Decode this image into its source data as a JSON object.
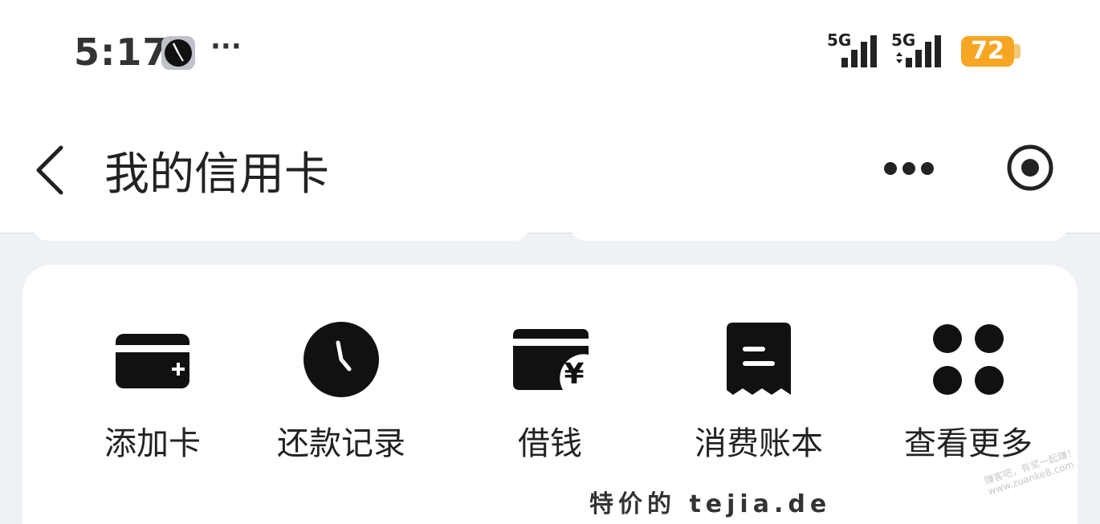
{
  "status": {
    "time": "5:17",
    "more": "···",
    "network1": "5G",
    "network2": "5G",
    "battery": "72",
    "battery_color": "#f6a623"
  },
  "nav": {
    "back_icon": "chevron-left-icon",
    "title": "我的信用卡",
    "more_icon": "more-horizontal-icon",
    "target_icon": "target-icon"
  },
  "actions": [
    {
      "label": "添加卡",
      "icon": "add-card-icon"
    },
    {
      "label": "还款记录",
      "icon": "clock-icon"
    },
    {
      "label": "借钱",
      "icon": "card-yuan-icon"
    },
    {
      "label": "消费账本",
      "icon": "receipt-icon"
    },
    {
      "label": "查看更多",
      "icon": "grid-dots-icon"
    }
  ],
  "watermark": {
    "text": "特价的 tejia.de",
    "stamp": "赚客吧，有奖一起赚！ www.zuanke8.com"
  }
}
